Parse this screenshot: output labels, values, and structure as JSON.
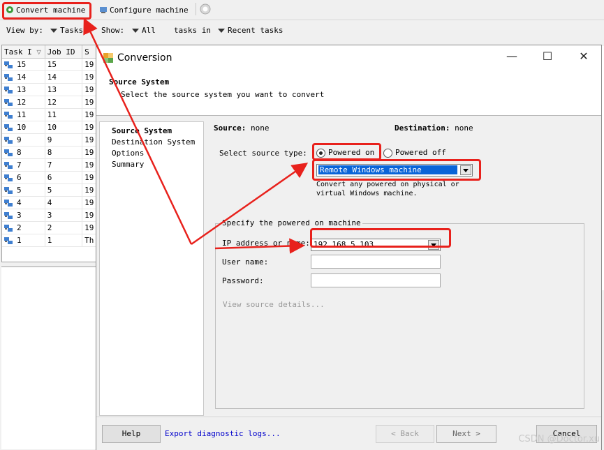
{
  "toolbar": {
    "convert_label": "Convert machine",
    "configure_label": "Configure machine"
  },
  "filterbar": {
    "view_by_label": "View by:",
    "view_by_value": "Tasks",
    "show_label": "Show:",
    "show_value": "All",
    "tasks_in_label": "tasks in",
    "tasks_in_value": "Recent tasks"
  },
  "task_table": {
    "headers": [
      "Task I",
      "Job ID",
      "S"
    ],
    "rows": [
      [
        "15",
        "15",
        "19"
      ],
      [
        "14",
        "14",
        "19"
      ],
      [
        "13",
        "13",
        "19"
      ],
      [
        "12",
        "12",
        "19"
      ],
      [
        "11",
        "11",
        "19"
      ],
      [
        "10",
        "10",
        "19"
      ],
      [
        "9",
        "9",
        "19"
      ],
      [
        "8",
        "8",
        "19"
      ],
      [
        "7",
        "7",
        "19"
      ],
      [
        "6",
        "6",
        "19"
      ],
      [
        "5",
        "5",
        "19"
      ],
      [
        "4",
        "4",
        "19"
      ],
      [
        "3",
        "3",
        "19"
      ],
      [
        "2",
        "2",
        "19"
      ],
      [
        "1",
        "1",
        "Th"
      ]
    ]
  },
  "dialog": {
    "title": "Conversion",
    "header_title": "Source System",
    "header_subtitle": "Select the source system you want to convert",
    "steps": [
      "Source System",
      "Destination System",
      "Options",
      "Summary"
    ],
    "source_label": "Source:",
    "source_value": "none",
    "destination_label": "Destination:",
    "destination_value": "none",
    "select_source_type": "Select source type:",
    "powered_on": "Powered on",
    "powered_off": "Powered off",
    "machine_type": "Remote Windows machine",
    "machine_desc_1": "Convert any powered on physical or",
    "machine_desc_2": "virtual Windows machine.",
    "group_title": "Specify the powered on machine",
    "ip_label": "IP address or name:",
    "ip_value": "192.168.5.103",
    "user_label": "User name:",
    "user_value": "",
    "password_label": "Password:",
    "password_value": "",
    "view_details": "View source details...",
    "help_button": "Help",
    "export_logs": "Export diagnostic logs...",
    "back_button": "< Back",
    "next_button": "Next >",
    "cancel_button": "Cancel"
  },
  "watermark": "CSDN @Doctor.xu",
  "colors": {
    "annotation_red": "#e8211c",
    "link_blue": "#0000cc",
    "selection_blue": "#0a64d8"
  }
}
